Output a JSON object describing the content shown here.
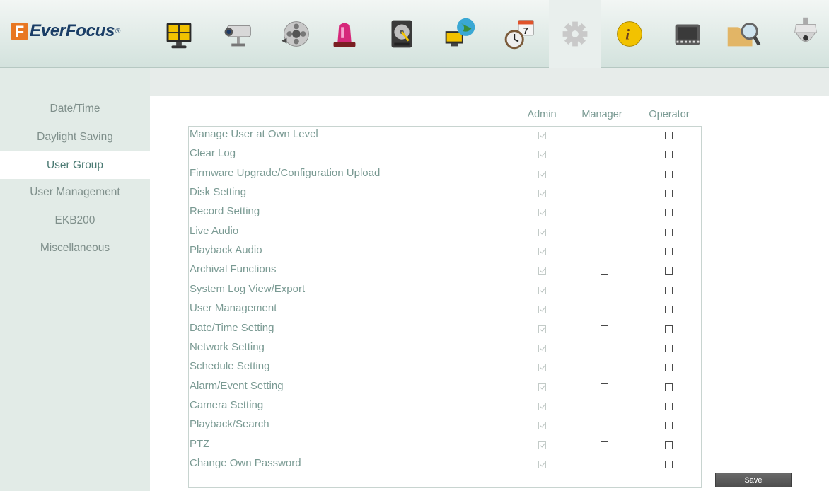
{
  "brand": {
    "logo_letter": "F",
    "name": "EverFocus",
    "reg": "®"
  },
  "toolbar": [
    {
      "name": "live-view-icon"
    },
    {
      "name": "camera-icon"
    },
    {
      "name": "record-icon"
    },
    {
      "name": "alarm-icon"
    },
    {
      "name": "disk-icon"
    },
    {
      "name": "network-icon"
    },
    {
      "name": "schedule-icon"
    },
    {
      "name": "settings-icon",
      "active": true
    },
    {
      "name": "info-icon"
    },
    {
      "name": "playback-icon"
    },
    {
      "name": "search-icon"
    },
    {
      "name": "ptz-icon"
    }
  ],
  "sidebar": {
    "items": [
      {
        "label": "Date/Time"
      },
      {
        "label": "Daylight Saving"
      },
      {
        "label": "User Group",
        "active": true
      },
      {
        "label": "User Management"
      },
      {
        "label": "EKB200"
      },
      {
        "label": "Miscellaneous"
      }
    ]
  },
  "table": {
    "columns": [
      "Admin",
      "Manager",
      "Operator"
    ],
    "rows": [
      {
        "label": "Manage User at Own Level",
        "admin": true,
        "manager": false,
        "operator": false
      },
      {
        "label": "Clear Log",
        "admin": true,
        "manager": false,
        "operator": false
      },
      {
        "label": "Firmware Upgrade/Configuration Upload",
        "admin": true,
        "manager": false,
        "operator": false
      },
      {
        "label": "Disk Setting",
        "admin": true,
        "manager": false,
        "operator": false
      },
      {
        "label": "Record Setting",
        "admin": true,
        "manager": false,
        "operator": false
      },
      {
        "label": "Live Audio",
        "admin": true,
        "manager": false,
        "operator": false
      },
      {
        "label": "Playback Audio",
        "admin": true,
        "manager": false,
        "operator": false
      },
      {
        "label": "Archival Functions",
        "admin": true,
        "manager": false,
        "operator": false
      },
      {
        "label": "System Log View/Export",
        "admin": true,
        "manager": false,
        "operator": false
      },
      {
        "label": "User Management",
        "admin": true,
        "manager": false,
        "operator": false
      },
      {
        "label": "Date/Time Setting",
        "admin": true,
        "manager": false,
        "operator": false
      },
      {
        "label": "Network Setting",
        "admin": true,
        "manager": false,
        "operator": false
      },
      {
        "label": "Schedule Setting",
        "admin": true,
        "manager": false,
        "operator": false
      },
      {
        "label": "Alarm/Event Setting",
        "admin": true,
        "manager": false,
        "operator": false
      },
      {
        "label": "Camera Setting",
        "admin": true,
        "manager": false,
        "operator": false
      },
      {
        "label": "Playback/Search",
        "admin": true,
        "manager": false,
        "operator": false
      },
      {
        "label": "PTZ",
        "admin": true,
        "manager": false,
        "operator": false
      },
      {
        "label": "Change Own Password",
        "admin": true,
        "manager": false,
        "operator": false
      }
    ]
  },
  "save_label": "Save"
}
